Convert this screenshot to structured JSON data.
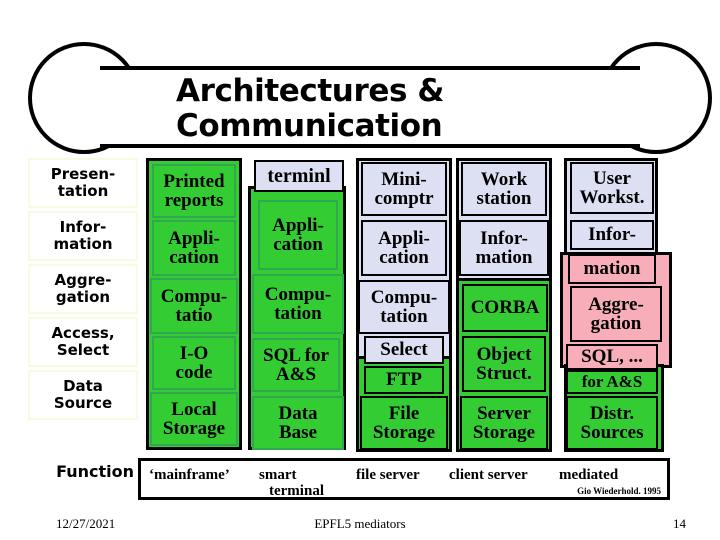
{
  "slide": {
    "title": "Architectures &\nCommunication"
  },
  "layers": [
    {
      "label": "Presen-\ntation"
    },
    {
      "label": "Infor-\nmation"
    },
    {
      "label": "Aggre-\ngation"
    },
    {
      "label": "Access,\nSelect"
    },
    {
      "label": "Data\nSource"
    }
  ],
  "columns": [
    {
      "name": "mainframe",
      "cells": [
        {
          "text": "Printed\nreports",
          "style": "green"
        },
        {
          "text": "Appli-\ncation",
          "style": "green"
        },
        {
          "text": "Compu-\ntatio",
          "style": "green"
        },
        {
          "text": "I-O\ncode",
          "style": "green"
        },
        {
          "text": "Local\nStorage",
          "style": "green"
        }
      ]
    },
    {
      "name": "smart-terminal",
      "cells": [
        {
          "text": "terminl",
          "style": "lav"
        },
        {
          "text": "Appli-\ncation",
          "style": "green"
        },
        {
          "text": "Compu-\ntation",
          "style": "green"
        },
        {
          "text": "SQL for\nA&S",
          "style": "green"
        },
        {
          "text": "Data\nBase",
          "style": "green"
        }
      ]
    },
    {
      "name": "file-server",
      "cells": [
        {
          "text": "Mini-\ncomptr",
          "style": "lav"
        },
        {
          "text": "Appli-\ncation",
          "style": "lav"
        },
        {
          "text": "Compu-\ntation",
          "style": "lav"
        },
        {
          "text": "Select",
          "style": "lav"
        },
        {
          "text": "FTP",
          "style": "green"
        },
        {
          "text": "File\nStorage",
          "style": "green"
        }
      ]
    },
    {
      "name": "client-server",
      "cells": [
        {
          "text": "Work\nstation",
          "style": "lav"
        },
        {
          "text": "Infor-\nmation",
          "style": "lav"
        },
        {
          "text": "CORBA",
          "style": "green"
        },
        {
          "text": "Object\nStruct.",
          "style": "green"
        },
        {
          "text": "Server\nStorage",
          "style": "green"
        }
      ]
    },
    {
      "name": "mediated",
      "cells": [
        {
          "text": "User\nWorkst.",
          "style": "lav"
        },
        {
          "text": "Infor-",
          "style": "lav"
        },
        {
          "text": "mation",
          "style": "pink"
        },
        {
          "text": "Aggre-\ngation",
          "style": "pink"
        },
        {
          "text": "SQL, ...",
          "style": "pink"
        },
        {
          "text": "for A&S",
          "style": "green"
        },
        {
          "text": "Distr.\nSources",
          "style": "green"
        }
      ]
    }
  ],
  "function_row": {
    "label": "Function",
    "items": [
      "‘mainframe’",
      "smart",
      "terminal",
      "file server",
      "client server",
      "mediated"
    ],
    "credit": "Gio Wiederhold. 1995"
  },
  "footer": {
    "date": "12/27/2021",
    "center": "EPFL5 mediators",
    "page": "14"
  },
  "colors": {
    "green": "#33CC33",
    "lavender": "#DDE0F2",
    "pink": "#F7AEB8",
    "outline": "#000000"
  }
}
